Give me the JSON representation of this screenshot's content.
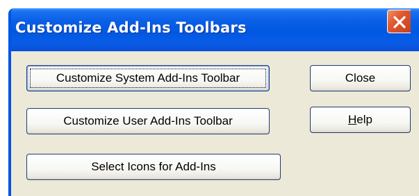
{
  "dialog": {
    "title": "Customize Add-Ins Toolbars"
  },
  "buttons": {
    "customize_system": "Customize System Add-Ins Toolbar",
    "customize_user": "Customize User Add-Ins Toolbar",
    "select_icons": "Select Icons for Add-Ins",
    "close": "Close",
    "help_mnemonic": "H",
    "help_rest": "elp"
  },
  "icons": {
    "close_window": "close-x-icon"
  },
  "colors": {
    "titlebar": "#0058e2",
    "close_button": "#e0582e",
    "dialog_face": "#ece9d8"
  }
}
